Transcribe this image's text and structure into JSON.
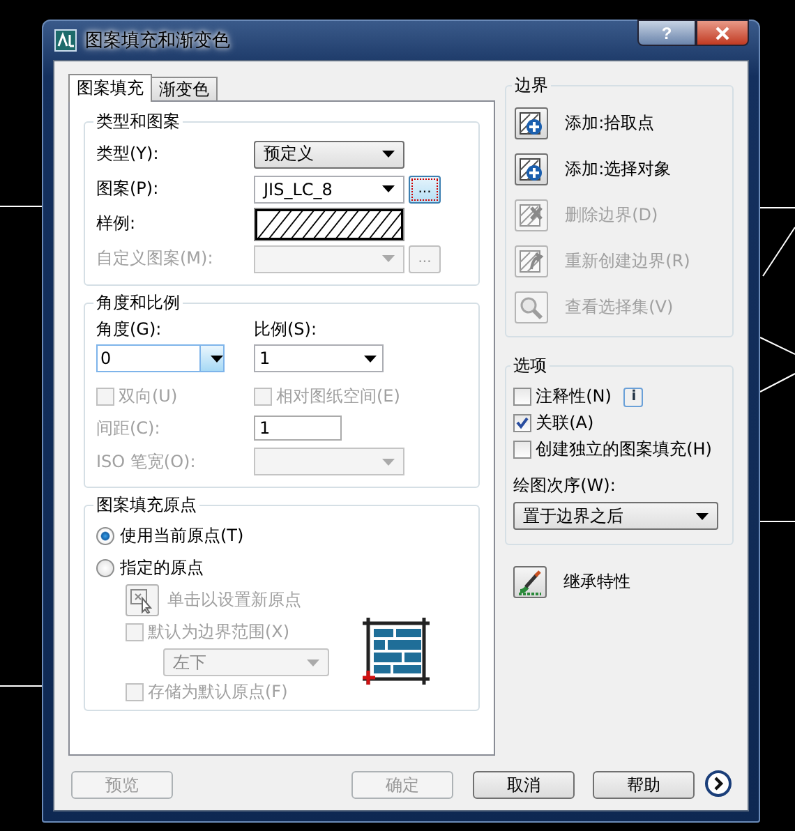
{
  "window": {
    "title": "图案填充和渐变色",
    "help": "?"
  },
  "tabs": [
    {
      "label": "图案填充",
      "selected": true
    },
    {
      "label": "渐变色",
      "selected": false
    }
  ],
  "type_and_pattern": {
    "title": "类型和图案",
    "fields": [
      {
        "kind": "select",
        "label": "类型(Y):",
        "value": "预定义",
        "disabled": false
      },
      {
        "kind": "select_browse",
        "label": "图案(P):",
        "value": "JIS_LC_8",
        "browse": "...",
        "disabled": false
      },
      {
        "kind": "swatch",
        "label": "样例:",
        "disabled": false
      },
      {
        "kind": "select_browse",
        "label": "自定义图案(M):",
        "browse": "...",
        "disabled": true
      }
    ]
  },
  "angle_and_scale": {
    "title": "角度和比例",
    "angle": {
      "label": "角度(G):",
      "value": "0"
    },
    "scale": {
      "label": "比例(S):",
      "value": "1"
    },
    "checks": [
      {
        "label": "双向(U)",
        "checked": false,
        "disabled": true
      },
      {
        "label": "相对图纸空间(E)",
        "checked": false,
        "disabled": true
      }
    ],
    "spacing": {
      "label": "间距(C):",
      "value": "1",
      "disabled": true
    },
    "iso_pen": {
      "label": "ISO 笔宽(O):",
      "disabled": true
    }
  },
  "origin": {
    "title": "图案填充原点",
    "radios": [
      {
        "label": "使用当前原点(T)",
        "selected": true
      },
      {
        "label": "指定的原点",
        "selected": false
      }
    ],
    "click_set": {
      "label": "单击以设置新原点",
      "disabled": true
    },
    "default_extents": {
      "label": "默认为边界范围(X)",
      "checked": false,
      "disabled": true
    },
    "position": {
      "value": "左下",
      "disabled": true
    },
    "store_default": {
      "label": "存储为默认原点(F)",
      "checked": false,
      "disabled": true
    }
  },
  "boundaries": {
    "title": "边界",
    "items": [
      {
        "kind": "pick",
        "label": "添加:拾取点",
        "disabled": false
      },
      {
        "kind": "select",
        "label": "添加:选择对象",
        "disabled": false
      },
      {
        "kind": "remove",
        "label": "删除边界(D)",
        "disabled": true
      },
      {
        "kind": "recreate",
        "label": "重新创建边界(R)",
        "disabled": true
      },
      {
        "kind": "view",
        "label": "查看选择集(V)",
        "disabled": true
      }
    ]
  },
  "options": {
    "title": "选项",
    "checks": [
      {
        "label": "注释性(N)",
        "checked": false,
        "info": "i"
      },
      {
        "label": "关联(A)",
        "checked": true
      },
      {
        "label": "创建独立的图案填充(H)",
        "checked": false
      }
    ],
    "draw_order": {
      "label": "绘图次序(W):",
      "value": "置于边界之后"
    }
  },
  "inherit": {
    "label": "继承特性"
  },
  "buttons": [
    {
      "label": "预览",
      "disabled": true
    },
    {
      "label": "确定",
      "disabled": true
    },
    {
      "label": "取消",
      "disabled": false
    },
    {
      "label": "帮助",
      "disabled": false
    }
  ]
}
